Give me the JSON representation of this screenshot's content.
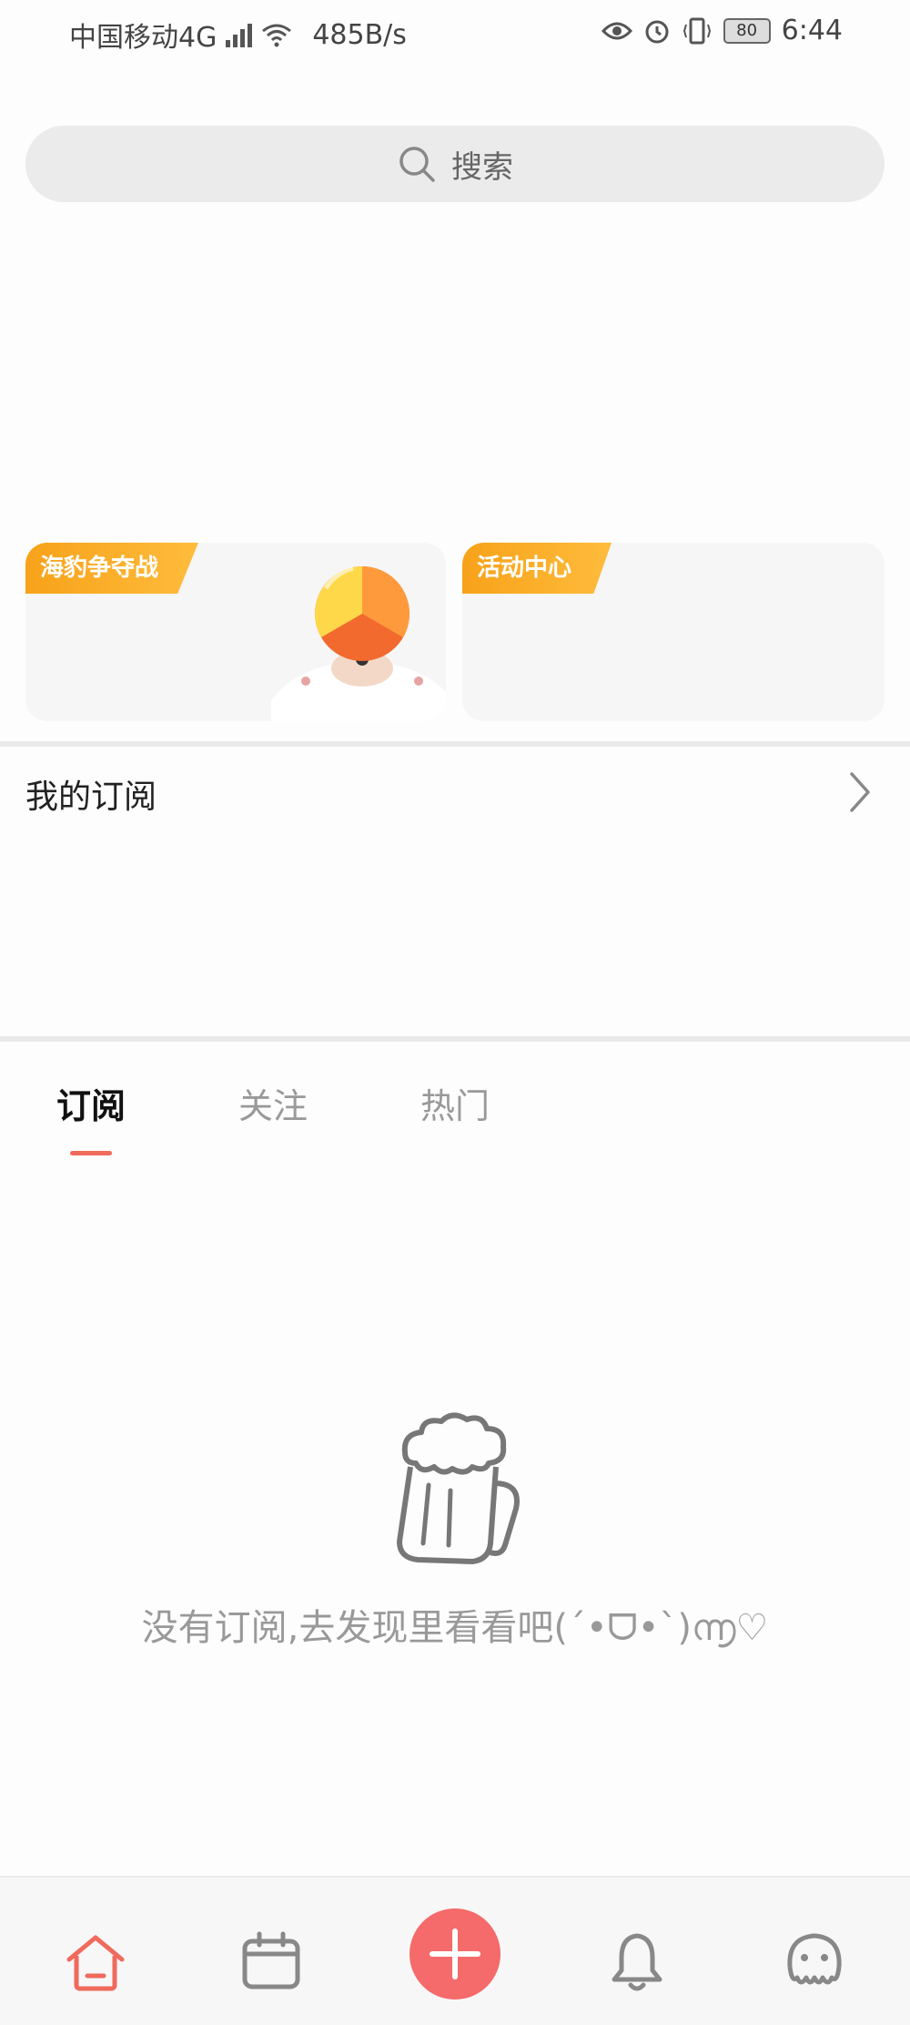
{
  "status_bar": {
    "carrier": "中国移动4G",
    "net_badge": "4G",
    "speed": "485B/s",
    "battery": "80",
    "time": "6:44"
  },
  "search": {
    "placeholder": "搜索"
  },
  "cards": [
    {
      "tag": "海豹争夺战"
    },
    {
      "tag": "活动中心"
    }
  ],
  "subscription_header": {
    "title": "我的订阅"
  },
  "tabs": [
    {
      "label": "订阅",
      "active": true
    },
    {
      "label": "关注",
      "active": false
    },
    {
      "label": "热门",
      "active": false
    }
  ],
  "empty_state": {
    "message": "没有订阅,去发现里看看吧(´•ᗜ•`)൬♡"
  },
  "bottom_nav": {
    "items": [
      "home-icon",
      "calendar-icon",
      "add-icon",
      "bell-icon",
      "octopus-icon"
    ],
    "accent": "#f56a6a"
  },
  "colors": {
    "accent": "#f06a5d",
    "tag": "#f7a21a"
  }
}
